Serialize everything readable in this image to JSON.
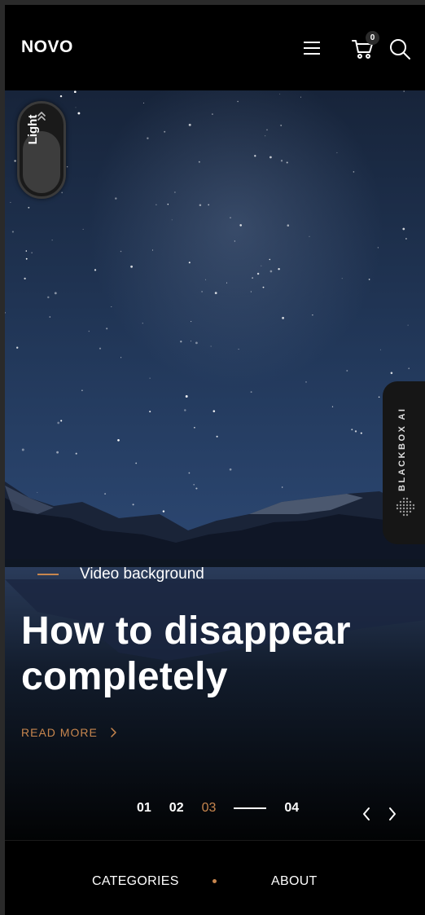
{
  "header": {
    "logo": "NOVO",
    "cart_count": "0"
  },
  "theme_toggle": {
    "label": "Light"
  },
  "side_widget": {
    "label": "BLACKBOX AI"
  },
  "hero": {
    "eyebrow": "Video background",
    "title": "How to disappear completely",
    "read_more": "READ MORE"
  },
  "pager": {
    "pages": [
      "01",
      "02",
      "03",
      "04"
    ],
    "active": "03"
  },
  "bottom_nav": {
    "categories": "CATEGORIES",
    "about": "ABOUT"
  },
  "colors": {
    "accent": "#c8864e",
    "background": "#000000"
  },
  "icons": [
    "hamburger-icon",
    "cart-icon",
    "search-icon",
    "chevron-up-double-icon",
    "chevron-right-icon",
    "chevron-left-icon"
  ]
}
